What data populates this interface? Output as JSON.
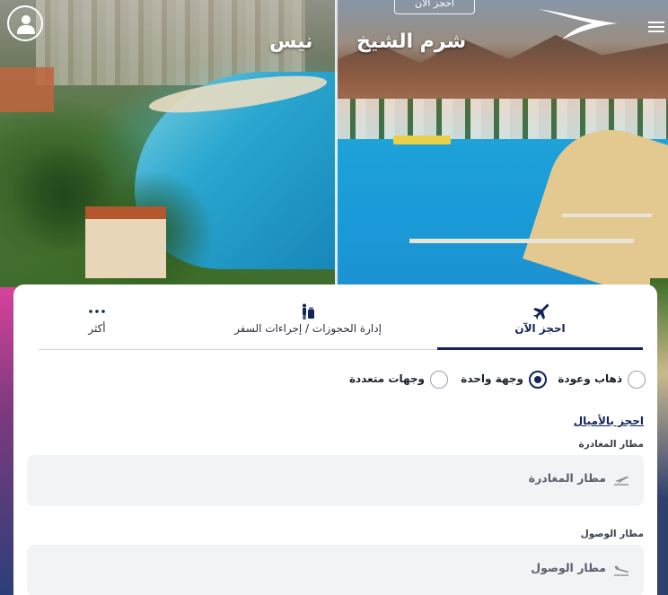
{
  "hero": {
    "left_city": "نيس",
    "right_city": "شرم الشيخ",
    "book_now_badge": "احجز الآن"
  },
  "header": {
    "user_icon": "user-icon",
    "logo_icon": "airline-logo-icon",
    "menu_icon": "hamburger-menu-icon"
  },
  "tabs": [
    {
      "label": "احجز الآن",
      "icon": "airplane-icon",
      "active": true
    },
    {
      "label": "إدارة الحجوزات / إجراءات السفر",
      "icon": "luggage-icon",
      "active": false
    },
    {
      "label": "أكثر",
      "icon": "more-dots-icon",
      "active": false
    }
  ],
  "trip_type": {
    "options": [
      {
        "label": "ذهاب وعودة",
        "selected": false
      },
      {
        "label": "وجهة واحدة",
        "selected": true
      },
      {
        "label": "وجهات متعددة",
        "selected": false
      }
    ]
  },
  "miles_link": "احجز بالأميال",
  "departure": {
    "label": "مطار المغادرة",
    "value": "مطار المغادرة",
    "icon": "departure-plane-icon"
  },
  "arrival": {
    "label": "مطار الوصول",
    "value": "مطار الوصول",
    "icon": "arrival-plane-icon"
  },
  "colors": {
    "brand": "#13235b",
    "field_bg": "#f2f3f5"
  }
}
